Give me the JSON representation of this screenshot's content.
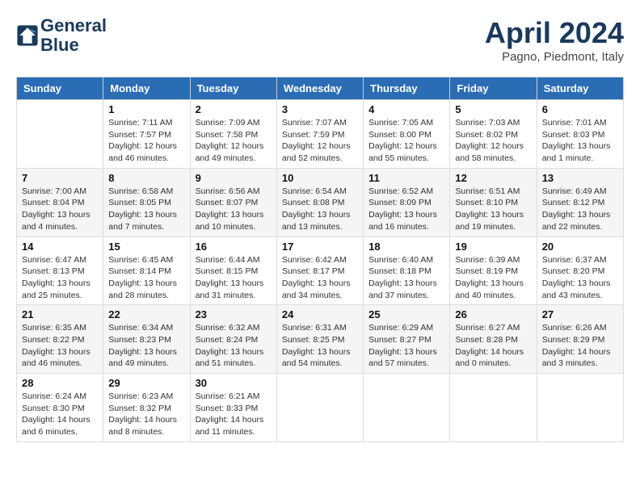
{
  "header": {
    "logo_line1": "General",
    "logo_line2": "Blue",
    "month_title": "April 2024",
    "location": "Pagno, Piedmont, Italy"
  },
  "weekdays": [
    "Sunday",
    "Monday",
    "Tuesday",
    "Wednesday",
    "Thursday",
    "Friday",
    "Saturday"
  ],
  "weeks": [
    [
      {
        "num": "",
        "sunrise": "",
        "sunset": "",
        "daylight": "",
        "empty": true
      },
      {
        "num": "1",
        "sunrise": "Sunrise: 7:11 AM",
        "sunset": "Sunset: 7:57 PM",
        "daylight": "Daylight: 12 hours and 46 minutes."
      },
      {
        "num": "2",
        "sunrise": "Sunrise: 7:09 AM",
        "sunset": "Sunset: 7:58 PM",
        "daylight": "Daylight: 12 hours and 49 minutes."
      },
      {
        "num": "3",
        "sunrise": "Sunrise: 7:07 AM",
        "sunset": "Sunset: 7:59 PM",
        "daylight": "Daylight: 12 hours and 52 minutes."
      },
      {
        "num": "4",
        "sunrise": "Sunrise: 7:05 AM",
        "sunset": "Sunset: 8:00 PM",
        "daylight": "Daylight: 12 hours and 55 minutes."
      },
      {
        "num": "5",
        "sunrise": "Sunrise: 7:03 AM",
        "sunset": "Sunset: 8:02 PM",
        "daylight": "Daylight: 12 hours and 58 minutes."
      },
      {
        "num": "6",
        "sunrise": "Sunrise: 7:01 AM",
        "sunset": "Sunset: 8:03 PM",
        "daylight": "Daylight: 13 hours and 1 minute."
      }
    ],
    [
      {
        "num": "7",
        "sunrise": "Sunrise: 7:00 AM",
        "sunset": "Sunset: 8:04 PM",
        "daylight": "Daylight: 13 hours and 4 minutes."
      },
      {
        "num": "8",
        "sunrise": "Sunrise: 6:58 AM",
        "sunset": "Sunset: 8:05 PM",
        "daylight": "Daylight: 13 hours and 7 minutes."
      },
      {
        "num": "9",
        "sunrise": "Sunrise: 6:56 AM",
        "sunset": "Sunset: 8:07 PM",
        "daylight": "Daylight: 13 hours and 10 minutes."
      },
      {
        "num": "10",
        "sunrise": "Sunrise: 6:54 AM",
        "sunset": "Sunset: 8:08 PM",
        "daylight": "Daylight: 13 hours and 13 minutes."
      },
      {
        "num": "11",
        "sunrise": "Sunrise: 6:52 AM",
        "sunset": "Sunset: 8:09 PM",
        "daylight": "Daylight: 13 hours and 16 minutes."
      },
      {
        "num": "12",
        "sunrise": "Sunrise: 6:51 AM",
        "sunset": "Sunset: 8:10 PM",
        "daylight": "Daylight: 13 hours and 19 minutes."
      },
      {
        "num": "13",
        "sunrise": "Sunrise: 6:49 AM",
        "sunset": "Sunset: 8:12 PM",
        "daylight": "Daylight: 13 hours and 22 minutes."
      }
    ],
    [
      {
        "num": "14",
        "sunrise": "Sunrise: 6:47 AM",
        "sunset": "Sunset: 8:13 PM",
        "daylight": "Daylight: 13 hours and 25 minutes."
      },
      {
        "num": "15",
        "sunrise": "Sunrise: 6:45 AM",
        "sunset": "Sunset: 8:14 PM",
        "daylight": "Daylight: 13 hours and 28 minutes."
      },
      {
        "num": "16",
        "sunrise": "Sunrise: 6:44 AM",
        "sunset": "Sunset: 8:15 PM",
        "daylight": "Daylight: 13 hours and 31 minutes."
      },
      {
        "num": "17",
        "sunrise": "Sunrise: 6:42 AM",
        "sunset": "Sunset: 8:17 PM",
        "daylight": "Daylight: 13 hours and 34 minutes."
      },
      {
        "num": "18",
        "sunrise": "Sunrise: 6:40 AM",
        "sunset": "Sunset: 8:18 PM",
        "daylight": "Daylight: 13 hours and 37 minutes."
      },
      {
        "num": "19",
        "sunrise": "Sunrise: 6:39 AM",
        "sunset": "Sunset: 8:19 PM",
        "daylight": "Daylight: 13 hours and 40 minutes."
      },
      {
        "num": "20",
        "sunrise": "Sunrise: 6:37 AM",
        "sunset": "Sunset: 8:20 PM",
        "daylight": "Daylight: 13 hours and 43 minutes."
      }
    ],
    [
      {
        "num": "21",
        "sunrise": "Sunrise: 6:35 AM",
        "sunset": "Sunset: 8:22 PM",
        "daylight": "Daylight: 13 hours and 46 minutes."
      },
      {
        "num": "22",
        "sunrise": "Sunrise: 6:34 AM",
        "sunset": "Sunset: 8:23 PM",
        "daylight": "Daylight: 13 hours and 49 minutes."
      },
      {
        "num": "23",
        "sunrise": "Sunrise: 6:32 AM",
        "sunset": "Sunset: 8:24 PM",
        "daylight": "Daylight: 13 hours and 51 minutes."
      },
      {
        "num": "24",
        "sunrise": "Sunrise: 6:31 AM",
        "sunset": "Sunset: 8:25 PM",
        "daylight": "Daylight: 13 hours and 54 minutes."
      },
      {
        "num": "25",
        "sunrise": "Sunrise: 6:29 AM",
        "sunset": "Sunset: 8:27 PM",
        "daylight": "Daylight: 13 hours and 57 minutes."
      },
      {
        "num": "26",
        "sunrise": "Sunrise: 6:27 AM",
        "sunset": "Sunset: 8:28 PM",
        "daylight": "Daylight: 14 hours and 0 minutes."
      },
      {
        "num": "27",
        "sunrise": "Sunrise: 6:26 AM",
        "sunset": "Sunset: 8:29 PM",
        "daylight": "Daylight: 14 hours and 3 minutes."
      }
    ],
    [
      {
        "num": "28",
        "sunrise": "Sunrise: 6:24 AM",
        "sunset": "Sunset: 8:30 PM",
        "daylight": "Daylight: 14 hours and 6 minutes."
      },
      {
        "num": "29",
        "sunrise": "Sunrise: 6:23 AM",
        "sunset": "Sunset: 8:32 PM",
        "daylight": "Daylight: 14 hours and 8 minutes."
      },
      {
        "num": "30",
        "sunrise": "Sunrise: 6:21 AM",
        "sunset": "Sunset: 8:33 PM",
        "daylight": "Daylight: 14 hours and 11 minutes."
      },
      {
        "num": "",
        "sunrise": "",
        "sunset": "",
        "daylight": "",
        "empty": true
      },
      {
        "num": "",
        "sunrise": "",
        "sunset": "",
        "daylight": "",
        "empty": true
      },
      {
        "num": "",
        "sunrise": "",
        "sunset": "",
        "daylight": "",
        "empty": true
      },
      {
        "num": "",
        "sunrise": "",
        "sunset": "",
        "daylight": "",
        "empty": true
      }
    ]
  ]
}
